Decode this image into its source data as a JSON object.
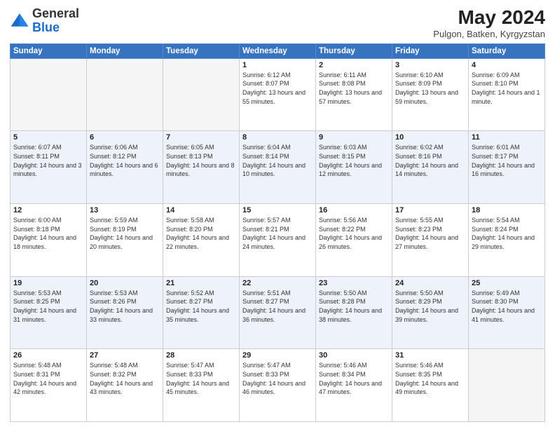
{
  "header": {
    "logo_general": "General",
    "logo_blue": "Blue",
    "month_title": "May 2024",
    "location": "Pulgon, Batken, Kyrgyzstan"
  },
  "weekdays": [
    "Sunday",
    "Monday",
    "Tuesday",
    "Wednesday",
    "Thursday",
    "Friday",
    "Saturday"
  ],
  "weeks": [
    [
      {
        "day": "",
        "sunrise": "",
        "sunset": "",
        "daylight": ""
      },
      {
        "day": "",
        "sunrise": "",
        "sunset": "",
        "daylight": ""
      },
      {
        "day": "",
        "sunrise": "",
        "sunset": "",
        "daylight": ""
      },
      {
        "day": "1",
        "sunrise": "Sunrise: 6:12 AM",
        "sunset": "Sunset: 8:07 PM",
        "daylight": "Daylight: 13 hours and 55 minutes."
      },
      {
        "day": "2",
        "sunrise": "Sunrise: 6:11 AM",
        "sunset": "Sunset: 8:08 PM",
        "daylight": "Daylight: 13 hours and 57 minutes."
      },
      {
        "day": "3",
        "sunrise": "Sunrise: 6:10 AM",
        "sunset": "Sunset: 8:09 PM",
        "daylight": "Daylight: 13 hours and 59 minutes."
      },
      {
        "day": "4",
        "sunrise": "Sunrise: 6:09 AM",
        "sunset": "Sunset: 8:10 PM",
        "daylight": "Daylight: 14 hours and 1 minute."
      }
    ],
    [
      {
        "day": "5",
        "sunrise": "Sunrise: 6:07 AM",
        "sunset": "Sunset: 8:11 PM",
        "daylight": "Daylight: 14 hours and 3 minutes."
      },
      {
        "day": "6",
        "sunrise": "Sunrise: 6:06 AM",
        "sunset": "Sunset: 8:12 PM",
        "daylight": "Daylight: 14 hours and 6 minutes."
      },
      {
        "day": "7",
        "sunrise": "Sunrise: 6:05 AM",
        "sunset": "Sunset: 8:13 PM",
        "daylight": "Daylight: 14 hours and 8 minutes."
      },
      {
        "day": "8",
        "sunrise": "Sunrise: 6:04 AM",
        "sunset": "Sunset: 8:14 PM",
        "daylight": "Daylight: 14 hours and 10 minutes."
      },
      {
        "day": "9",
        "sunrise": "Sunrise: 6:03 AM",
        "sunset": "Sunset: 8:15 PM",
        "daylight": "Daylight: 14 hours and 12 minutes."
      },
      {
        "day": "10",
        "sunrise": "Sunrise: 6:02 AM",
        "sunset": "Sunset: 8:16 PM",
        "daylight": "Daylight: 14 hours and 14 minutes."
      },
      {
        "day": "11",
        "sunrise": "Sunrise: 6:01 AM",
        "sunset": "Sunset: 8:17 PM",
        "daylight": "Daylight: 14 hours and 16 minutes."
      }
    ],
    [
      {
        "day": "12",
        "sunrise": "Sunrise: 6:00 AM",
        "sunset": "Sunset: 8:18 PM",
        "daylight": "Daylight: 14 hours and 18 minutes."
      },
      {
        "day": "13",
        "sunrise": "Sunrise: 5:59 AM",
        "sunset": "Sunset: 8:19 PM",
        "daylight": "Daylight: 14 hours and 20 minutes."
      },
      {
        "day": "14",
        "sunrise": "Sunrise: 5:58 AM",
        "sunset": "Sunset: 8:20 PM",
        "daylight": "Daylight: 14 hours and 22 minutes."
      },
      {
        "day": "15",
        "sunrise": "Sunrise: 5:57 AM",
        "sunset": "Sunset: 8:21 PM",
        "daylight": "Daylight: 14 hours and 24 minutes."
      },
      {
        "day": "16",
        "sunrise": "Sunrise: 5:56 AM",
        "sunset": "Sunset: 8:22 PM",
        "daylight": "Daylight: 14 hours and 26 minutes."
      },
      {
        "day": "17",
        "sunrise": "Sunrise: 5:55 AM",
        "sunset": "Sunset: 8:23 PM",
        "daylight": "Daylight: 14 hours and 27 minutes."
      },
      {
        "day": "18",
        "sunrise": "Sunrise: 5:54 AM",
        "sunset": "Sunset: 8:24 PM",
        "daylight": "Daylight: 14 hours and 29 minutes."
      }
    ],
    [
      {
        "day": "19",
        "sunrise": "Sunrise: 5:53 AM",
        "sunset": "Sunset: 8:25 PM",
        "daylight": "Daylight: 14 hours and 31 minutes."
      },
      {
        "day": "20",
        "sunrise": "Sunrise: 5:53 AM",
        "sunset": "Sunset: 8:26 PM",
        "daylight": "Daylight: 14 hours and 33 minutes."
      },
      {
        "day": "21",
        "sunrise": "Sunrise: 5:52 AM",
        "sunset": "Sunset: 8:27 PM",
        "daylight": "Daylight: 14 hours and 35 minutes."
      },
      {
        "day": "22",
        "sunrise": "Sunrise: 5:51 AM",
        "sunset": "Sunset: 8:27 PM",
        "daylight": "Daylight: 14 hours and 36 minutes."
      },
      {
        "day": "23",
        "sunrise": "Sunrise: 5:50 AM",
        "sunset": "Sunset: 8:28 PM",
        "daylight": "Daylight: 14 hours and 38 minutes."
      },
      {
        "day": "24",
        "sunrise": "Sunrise: 5:50 AM",
        "sunset": "Sunset: 8:29 PM",
        "daylight": "Daylight: 14 hours and 39 minutes."
      },
      {
        "day": "25",
        "sunrise": "Sunrise: 5:49 AM",
        "sunset": "Sunset: 8:30 PM",
        "daylight": "Daylight: 14 hours and 41 minutes."
      }
    ],
    [
      {
        "day": "26",
        "sunrise": "Sunrise: 5:48 AM",
        "sunset": "Sunset: 8:31 PM",
        "daylight": "Daylight: 14 hours and 42 minutes."
      },
      {
        "day": "27",
        "sunrise": "Sunrise: 5:48 AM",
        "sunset": "Sunset: 8:32 PM",
        "daylight": "Daylight: 14 hours and 43 minutes."
      },
      {
        "day": "28",
        "sunrise": "Sunrise: 5:47 AM",
        "sunset": "Sunset: 8:33 PM",
        "daylight": "Daylight: 14 hours and 45 minutes."
      },
      {
        "day": "29",
        "sunrise": "Sunrise: 5:47 AM",
        "sunset": "Sunset: 8:33 PM",
        "daylight": "Daylight: 14 hours and 46 minutes."
      },
      {
        "day": "30",
        "sunrise": "Sunrise: 5:46 AM",
        "sunset": "Sunset: 8:34 PM",
        "daylight": "Daylight: 14 hours and 47 minutes."
      },
      {
        "day": "31",
        "sunrise": "Sunrise: 5:46 AM",
        "sunset": "Sunset: 8:35 PM",
        "daylight": "Daylight: 14 hours and 49 minutes."
      },
      {
        "day": "",
        "sunrise": "",
        "sunset": "",
        "daylight": ""
      }
    ]
  ]
}
